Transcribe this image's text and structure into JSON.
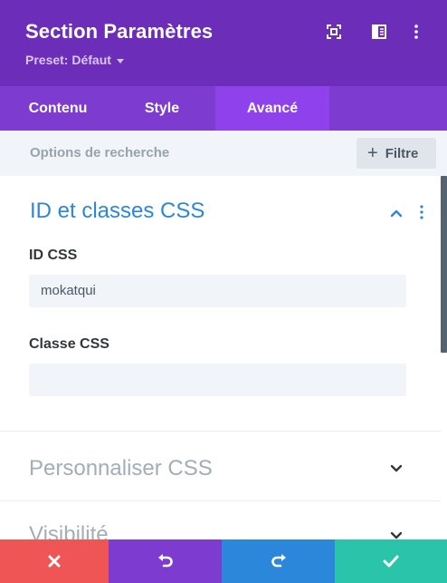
{
  "header": {
    "title": "Section Paramètres",
    "preset": "Preset: Défaut"
  },
  "tabs": [
    {
      "label": "Contenu"
    },
    {
      "label": "Style"
    },
    {
      "label": "Avancé",
      "active": true
    }
  ],
  "search": {
    "placeholder": "Options de recherche",
    "filter_label": "Filtre"
  },
  "sections": {
    "css": {
      "title": "ID et classes CSS",
      "css_id_label": "ID CSS",
      "css_id_value": "mokatqui",
      "css_class_label": "Classe CSS",
      "css_class_value": ""
    },
    "custom_css": {
      "title": "Personnaliser CSS"
    },
    "visibility": {
      "title": "Visibilité"
    }
  },
  "colors": {
    "header_bg": "#6c2eb9",
    "tabs_bg": "#7e3bd0",
    "active_tab_bg": "#8f42ec",
    "accent_blue": "#2b87da",
    "cancel": "#ef5555",
    "undo": "#7d3bcf",
    "redo": "#2b87da",
    "save": "#29c4a9"
  },
  "icons": {
    "header": [
      "fullscreen-icon",
      "sidebar-toggle-icon",
      "more-vertical-icon"
    ],
    "footer": [
      "close-icon",
      "undo-icon",
      "redo-icon",
      "check-icon"
    ]
  }
}
